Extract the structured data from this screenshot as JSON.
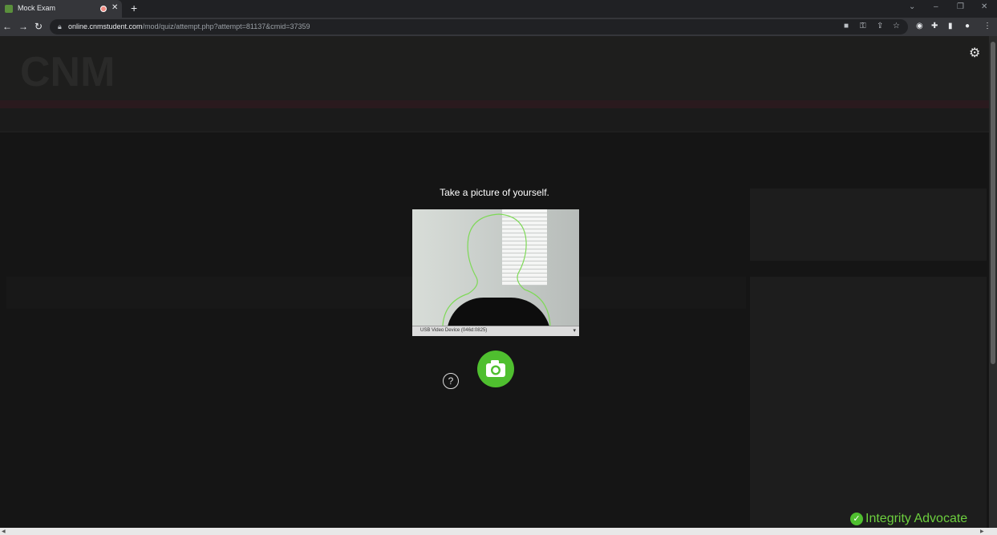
{
  "browser": {
    "tab_title": "Mock Exam",
    "tab_close": "✕",
    "new_tab": "+",
    "url_host": "online.cnmstudent.com",
    "url_path": "/mod/quiz/attempt.php?attempt=81137&cmid=37359",
    "window_controls": [
      "⌄",
      "–",
      "❐",
      "✕"
    ]
  },
  "modal": {
    "title": "Take a picture of yourself.",
    "camera_device": "USB Video Device (046d:0825)",
    "help_label": "?"
  },
  "badge": {
    "text": "Integrity Advocate",
    "check": "✓"
  },
  "colors": {
    "accent_green": "#4fbf2f",
    "badge_text": "#6ccf3e",
    "overlay_bg": "#151515"
  },
  "icons": [
    "lock-icon",
    "camera-icon",
    "key-icon",
    "share-icon",
    "star-icon",
    "extension-icon",
    "profile-icon",
    "menu-icon",
    "gear-icon",
    "help-icon",
    "check-icon"
  ]
}
